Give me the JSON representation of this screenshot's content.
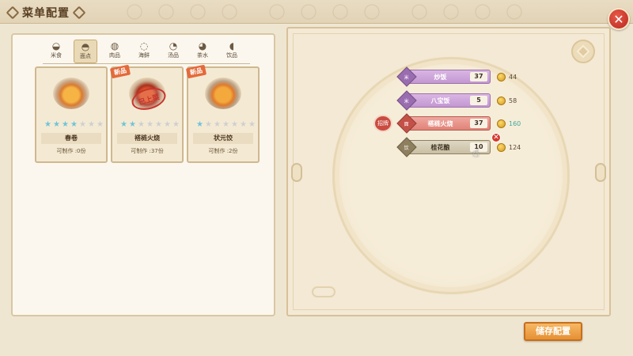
{
  "window": {
    "title": "菜单配置"
  },
  "categories": [
    {
      "label": "米食",
      "icon": "rice-bowl-icon",
      "glyph": "◒",
      "active": false
    },
    {
      "label": "面点",
      "icon": "noodle-bowl-icon",
      "glyph": "◓",
      "active": true
    },
    {
      "label": "肉品",
      "icon": "meat-icon",
      "glyph": "◍",
      "active": false
    },
    {
      "label": "海鲜",
      "icon": "shrimp-icon",
      "glyph": "◌",
      "active": false
    },
    {
      "label": "汤品",
      "icon": "soup-icon",
      "glyph": "◔",
      "active": false
    },
    {
      "label": "茶水",
      "icon": "teapot-icon",
      "glyph": "◕",
      "active": false
    },
    {
      "label": "饮品",
      "icon": "bottle-icon",
      "glyph": "◖",
      "active": false
    }
  ],
  "dishes": [
    {
      "name": "春卷",
      "craftable": "可制作 :0份",
      "stars": 4,
      "max_stars": 7,
      "new": false,
      "on_menu": false
    },
    {
      "name": "褡裢火烧",
      "craftable": "可制作 :37份",
      "stars": 2,
      "max_stars": 7,
      "new": true,
      "new_label": "新品",
      "on_menu": true,
      "stamp_label": "已上菜"
    },
    {
      "name": "状元饺",
      "craftable": "可制作 :2份",
      "stars": 1,
      "max_stars": 7,
      "new": true,
      "new_label": "新品",
      "on_menu": false
    }
  ],
  "menu": [
    {
      "tag": "米",
      "name": "炒饭",
      "qty": "37",
      "price": "44",
      "color": "purple"
    },
    {
      "tag": "米",
      "name": "八宝饭",
      "qty": "5",
      "price": "58",
      "color": "purple"
    },
    {
      "tag": "面",
      "name": "褡裢火烧",
      "qty": "37",
      "price": "160",
      "color": "pink",
      "signature": "招牌",
      "highlight_price": true
    },
    {
      "tag": "饮",
      "name": "桂花酿",
      "qty": "10",
      "price": "124",
      "color": "tan",
      "removable": true,
      "remove_glyph": "✕"
    }
  ],
  "actions": {
    "save_label": "储存配置",
    "close_glyph": "✕"
  },
  "colors": {
    "accent": "#e69034",
    "close": "#c8372b",
    "star_on": "#6fc4d8",
    "price_green": "#3fa89a"
  }
}
